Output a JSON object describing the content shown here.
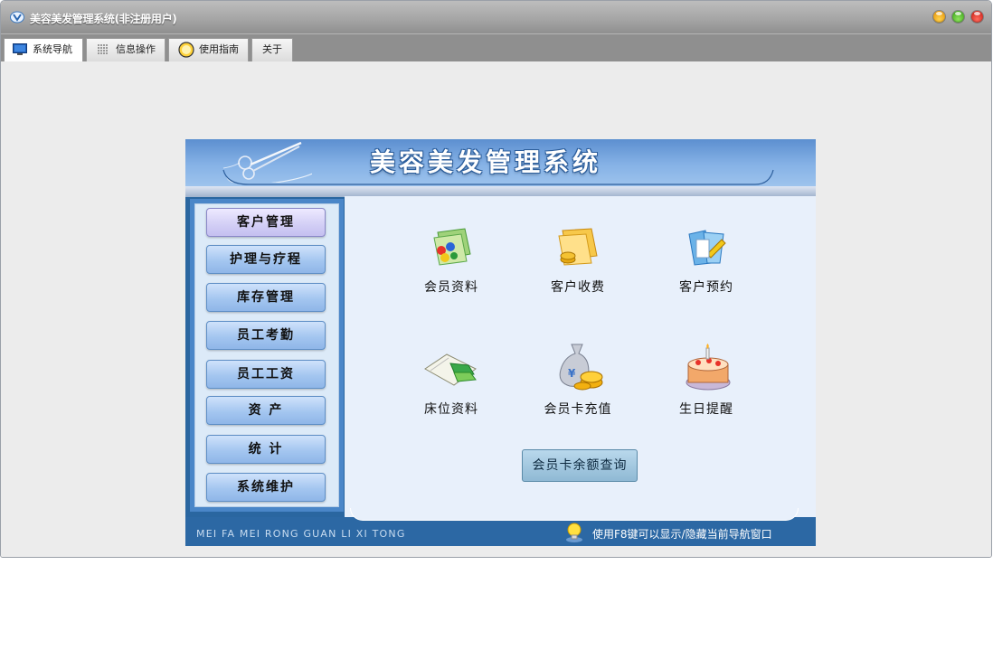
{
  "window": {
    "title": "美容美发管理系统(非注册用户)"
  },
  "tabs": [
    {
      "label": "系统导航",
      "icon": "monitor-icon",
      "active": true
    },
    {
      "label": "信息操作",
      "icon": "grid-icon",
      "active": false
    },
    {
      "label": "使用指南",
      "icon": "clock-icon",
      "active": false
    },
    {
      "label": "关于",
      "icon": "",
      "active": false
    }
  ],
  "banner": {
    "title": "美容美发管理系统",
    "logo": "scissors-logo"
  },
  "sidebar": {
    "items": [
      {
        "label": "客户管理",
        "active": true
      },
      {
        "label": "护理与疗程",
        "active": false
      },
      {
        "label": "库存管理",
        "active": false
      },
      {
        "label": "员工考勤",
        "active": false
      },
      {
        "label": "员工工资",
        "active": false
      },
      {
        "label": "资 产",
        "active": false
      },
      {
        "label": "统 计",
        "active": false
      },
      {
        "label": "系统维护",
        "active": false
      }
    ]
  },
  "features": [
    {
      "label": "会员资料",
      "icon": "member-folder-icon"
    },
    {
      "label": "客户收费",
      "icon": "fee-folder-icon"
    },
    {
      "label": "客户预约",
      "icon": "appointment-folder-icon"
    },
    {
      "label": "床位资料",
      "icon": "bed-book-icon"
    },
    {
      "label": "会员卡充值",
      "icon": "money-bag-icon"
    },
    {
      "label": "生日提醒",
      "icon": "birthday-cake-icon"
    }
  ],
  "query_button": {
    "label": "会员卡余额查询"
  },
  "footer": {
    "pinyin": "MEI FA MEI RONG GUAN LI XI TONG",
    "hint": "使用F8键可以显示/隐藏当前导航窗口"
  },
  "colors": {
    "panel_blue": "#2a66a0",
    "main_bg": "#e8f0fb",
    "nav_active": "#d4d0f6"
  }
}
